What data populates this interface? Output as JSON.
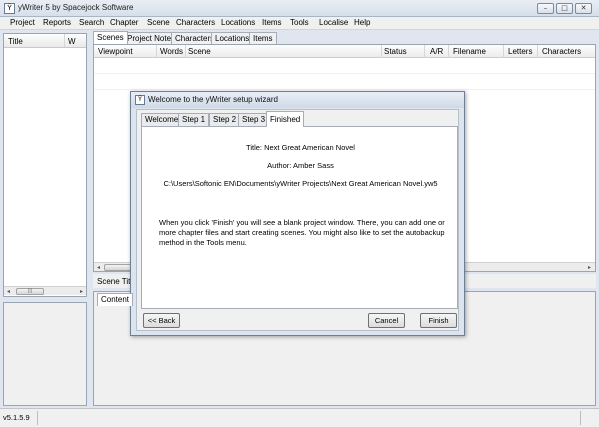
{
  "window": {
    "title": "yWriter 5 by Spacejock Software",
    "icon_glyph": "Ÿ",
    "minimize": "–",
    "maximize": "□",
    "close": "✕"
  },
  "menu": [
    "Project",
    "Reports",
    "Search",
    "Chapter",
    "Scene",
    "Characters",
    "Locations",
    "Items",
    "Tools",
    "Localise",
    "Help"
  ],
  "chapter_list": {
    "columns": [
      "Title",
      "W"
    ],
    "scroll_left": "◂",
    "scroll_right": "▸",
    "thumb": "|||"
  },
  "tabs": [
    "Scenes",
    "Project Notes",
    "Characters",
    "Locations",
    "Items"
  ],
  "scene_grid": {
    "columns": [
      "Viewpoint",
      "Words",
      "Scene",
      "Status",
      "A/R",
      "Filename",
      "Letters",
      "Characters"
    ],
    "scroll_left": "◂",
    "scroll_right": "▸"
  },
  "scene_title_label": "Scene Title",
  "content_tab": "Content",
  "status_bar": {
    "version": "v5.1.5.9"
  },
  "dialog": {
    "title": "Welcome to the yWriter setup wizard",
    "tabs": [
      "Welcome",
      "Step 1",
      "Step 2",
      "Step 3",
      "Finished"
    ],
    "active_tab": "Finished",
    "title_line": "Title: Next Great American Novel",
    "author_line": "Author: Amber Sass",
    "path_line": "C:\\Users\\Softonic EN\\Documents\\yWriter Projects\\Next Great American Novel.yw5",
    "description": "When you click 'Finish' you will see a blank project window. There, you can add one or more chapter files and start creating scenes. You might also like to set the autobackup method in the Tools menu.",
    "back_button": "<< Back",
    "cancel_button": "Cancel",
    "finish_button": "Finish"
  },
  "colors": {
    "chrome": "#dfe6ef",
    "panel": "#f0f0f0",
    "border": "#9aa5b1"
  }
}
